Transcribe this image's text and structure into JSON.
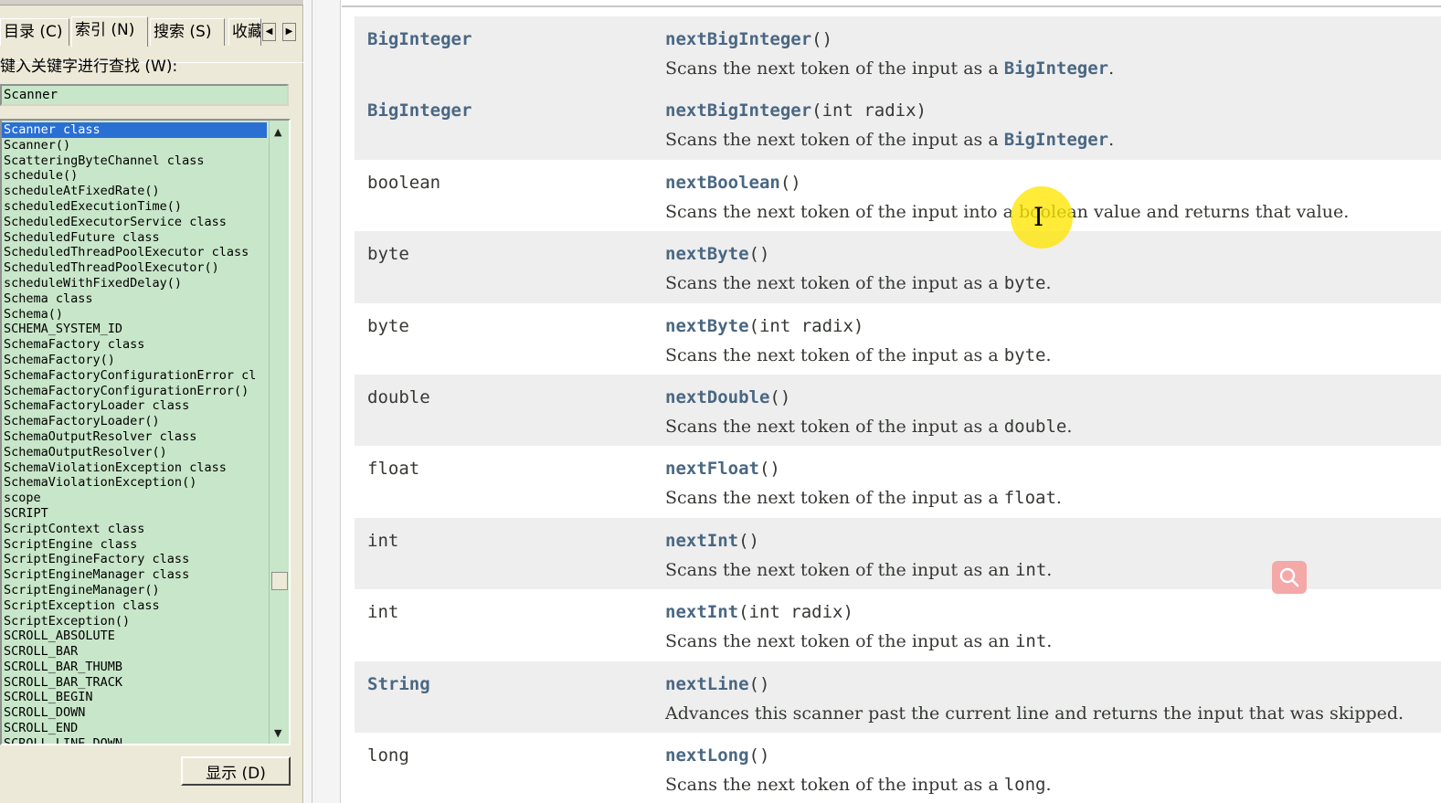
{
  "sidebar": {
    "tabs": [
      {
        "label": "目录 (C)"
      },
      {
        "label": "索引 (N)"
      },
      {
        "label": "搜索 (S)"
      },
      {
        "label": "收藏"
      }
    ],
    "keyword_label": "键入关键字进行查找 (W):",
    "search_value": "Scanner",
    "items": [
      "Scanner class",
      "Scanner()",
      "ScatteringByteChannel class",
      "schedule()",
      "scheduleAtFixedRate()",
      "scheduledExecutionTime()",
      "ScheduledExecutorService class",
      "ScheduledFuture class",
      "ScheduledThreadPoolExecutor class",
      "ScheduledThreadPoolExecutor()",
      "scheduleWithFixedDelay()",
      "Schema class",
      "Schema()",
      "SCHEMA_SYSTEM_ID",
      "SchemaFactory class",
      "SchemaFactory()",
      "SchemaFactoryConfigurationError cl",
      "SchemaFactoryConfigurationError()",
      "SchemaFactoryLoader class",
      "SchemaFactoryLoader()",
      "SchemaOutputResolver class",
      "SchemaOutputResolver()",
      "SchemaViolationException class",
      "SchemaViolationException()",
      "scope",
      "SCRIPT",
      "ScriptContext class",
      "ScriptEngine class",
      "ScriptEngineFactory class",
      "ScriptEngineManager class",
      "ScriptEngineManager()",
      "ScriptException class",
      "ScriptException()",
      "SCROLL_ABSOLUTE",
      "SCROLL_BAR",
      "SCROLL_BAR_THUMB",
      "SCROLL_BAR_TRACK",
      "SCROLL_BEGIN",
      "SCROLL_DOWN",
      "SCROLL_END",
      "SCROLL_LINE_DOWN"
    ],
    "selected_index": 0,
    "show_button": "显示 (D)"
  },
  "methods": [
    {
      "ret": "BigInteger",
      "ret_link": true,
      "name": "nextBigInteger",
      "params": "()",
      "desc_pre": "Scans the next token of the input as a ",
      "desc_code": "BigInteger",
      "desc_code_link": true,
      "desc_post": "."
    },
    {
      "ret": "BigInteger",
      "ret_link": true,
      "name": "nextBigInteger",
      "params": "(int radix)",
      "desc_pre": "Scans the next token of the input as a ",
      "desc_code": "BigInteger",
      "desc_code_link": true,
      "desc_post": "."
    },
    {
      "ret": "boolean",
      "ret_link": false,
      "name": "nextBoolean",
      "params": "()",
      "desc_pre": "Scans the next token of the input into a boolean value and returns that value.",
      "desc_code": "",
      "desc_code_link": false,
      "desc_post": ""
    },
    {
      "ret": "byte",
      "ret_link": false,
      "name": "nextByte",
      "params": "()",
      "desc_pre": "Scans the next token of the input as a ",
      "desc_code": "byte",
      "desc_code_link": false,
      "desc_post": "."
    },
    {
      "ret": "byte",
      "ret_link": false,
      "name": "nextByte",
      "params": "(int radix)",
      "desc_pre": "Scans the next token of the input as a ",
      "desc_code": "byte",
      "desc_code_link": false,
      "desc_post": "."
    },
    {
      "ret": "double",
      "ret_link": false,
      "name": "nextDouble",
      "params": "()",
      "desc_pre": "Scans the next token of the input as a ",
      "desc_code": "double",
      "desc_code_link": false,
      "desc_post": "."
    },
    {
      "ret": "float",
      "ret_link": false,
      "name": "nextFloat",
      "params": "()",
      "desc_pre": "Scans the next token of the input as a ",
      "desc_code": "float",
      "desc_code_link": false,
      "desc_post": "."
    },
    {
      "ret": "int",
      "ret_link": false,
      "name": "nextInt",
      "params": "()",
      "desc_pre": "Scans the next token of the input as an ",
      "desc_code": "int",
      "desc_code_link": false,
      "desc_post": "."
    },
    {
      "ret": "int",
      "ret_link": false,
      "name": "nextInt",
      "params": "(int radix)",
      "desc_pre": "Scans the next token of the input as an ",
      "desc_code": "int",
      "desc_code_link": false,
      "desc_post": "."
    },
    {
      "ret": "String",
      "ret_link": true,
      "name": "nextLine",
      "params": "()",
      "desc_pre": "Advances this scanner past the current line and returns the input that was skipped.",
      "desc_code": "",
      "desc_code_link": false,
      "desc_post": ""
    },
    {
      "ret": "long",
      "ret_link": false,
      "name": "nextLong",
      "params": "()",
      "desc_pre": "Scans the next token of the input as a ",
      "desc_code": "long",
      "desc_code_link": false,
      "desc_post": "."
    }
  ],
  "colors": {
    "link": "#4a6782",
    "text": "#353833",
    "list_bg": "#c8e6c9",
    "selection": "#2a6fd4",
    "row_alt": "#eeeeef",
    "cursor_highlight": "#ffe600"
  },
  "icons": {
    "text_cursor": "I-beam-cursor-icon",
    "floating_search": "search-icon"
  }
}
